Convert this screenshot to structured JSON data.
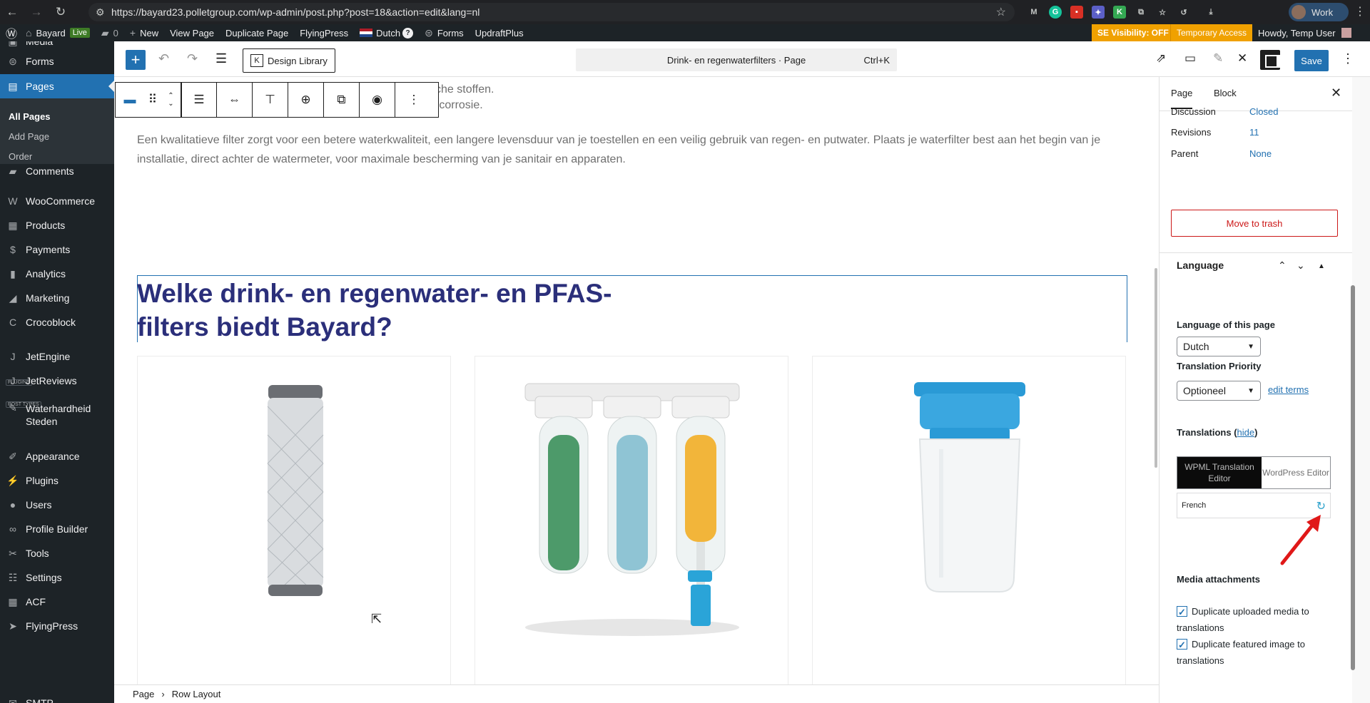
{
  "browser": {
    "url": "https://bayard23.polletgroup.com/wp-admin/post.php?post=18&action=edit&lang=nl",
    "profile": "Work"
  },
  "admin_bar": {
    "site": "Bayard",
    "live": "Live",
    "comments": "0",
    "new": "New",
    "view_page": "View Page",
    "duplicate_page": "Duplicate Page",
    "flyingpress": "FlyingPress",
    "language": "Dutch",
    "forms": "Forms",
    "updraft": "UpdraftPlus",
    "se_visibility": "SE Visibility: OFF",
    "temp_access": "Temporary Access",
    "howdy": "Howdy, Temp User"
  },
  "sidebar": {
    "items": [
      {
        "label": "Media",
        "icon": "media-icon"
      },
      {
        "label": "Forms",
        "icon": "forms-icon"
      },
      {
        "label": "Pages",
        "icon": "pages-icon"
      },
      {
        "label": "Comments",
        "icon": "comments-icon"
      },
      {
        "label": "WooCommerce",
        "icon": "woocommerce-icon"
      },
      {
        "label": "Products",
        "icon": "products-icon"
      },
      {
        "label": "Payments",
        "icon": "payments-icon"
      },
      {
        "label": "Analytics",
        "icon": "analytics-icon"
      },
      {
        "label": "Marketing",
        "icon": "marketing-icon"
      },
      {
        "label": "Crocoblock",
        "icon": "crocoblock-icon"
      },
      {
        "label": "JetEngine",
        "icon": "jetengine-icon"
      },
      {
        "label": "JetReviews",
        "icon": "jetreviews-icon"
      },
      {
        "label": "Waterhardheid Steden",
        "icon": "post-type-icon"
      },
      {
        "label": "Appearance",
        "icon": "appearance-icon"
      },
      {
        "label": "Plugins",
        "icon": "plugins-icon"
      },
      {
        "label": "Users",
        "icon": "users-icon"
      },
      {
        "label": "Profile Builder",
        "icon": "profile-builder-icon"
      },
      {
        "label": "Tools",
        "icon": "tools-icon"
      },
      {
        "label": "Settings",
        "icon": "settings-icon"
      },
      {
        "label": "ACF",
        "icon": "acf-icon"
      },
      {
        "label": "FlyingPress",
        "icon": "flyingpress-icon"
      },
      {
        "label": "SMTP",
        "icon": "smtp-icon"
      }
    ],
    "submenu": [
      "All Pages",
      "Add Page",
      "Order"
    ],
    "sep_plugins": "PLUGINS",
    "sep_post_types": "POST TYPES"
  },
  "editor": {
    "design_library": "Design Library",
    "doc_title": "Drink- en regenwaterfilters · Page",
    "shortcut": "Ctrl+K",
    "save": "Save"
  },
  "content": {
    "line1": "sche stoffen.",
    "line2": "n corrosie.",
    "paragraph": "Een kwalitatieve filter zorgt voor een betere waterkwaliteit, een langere levensduur van je toestellen en een veilig gebruik van regen- en putwater. Plaats je waterfilter best aan het begin van je installatie, direct achter de watermeter, voor maximale bescherming van je sanitair en apparaten.",
    "heading": "Welke drink- en regenwater- en PFAS-filters biedt Bayard?"
  },
  "breadcrumb": [
    "Page",
    "Row Layout"
  ],
  "settings": {
    "tab_page": "Page",
    "tab_block": "Block",
    "discussion_label": "Discussion",
    "discussion_value": "Closed",
    "revisions_label": "Revisions",
    "revisions_value": "11",
    "parent_label": "Parent",
    "parent_value": "None",
    "move_trash": "Move to trash",
    "language_title": "Language",
    "language_of_page": "Language of this page",
    "language_value": "Dutch",
    "translation_priority": "Translation Priority",
    "priority_value": "Optioneel",
    "edit_terms": "edit terms",
    "translations": "Translations",
    "hide": "hide",
    "wpml_editor": "WPML Translation Editor",
    "wp_editor": "WordPress Editor",
    "french": "French",
    "media_attachments": "Media attachments",
    "dup_media": "Duplicate uploaded media to translations",
    "dup_featured": "Duplicate featured image to translations"
  },
  "colors": {
    "wp_blue": "#2271b1",
    "heading": "#2b2f7a",
    "admin_bar": "#1d2327",
    "warning": "#f0a100",
    "trash": "#cc1818",
    "annotation_arrow": "#e01818"
  }
}
